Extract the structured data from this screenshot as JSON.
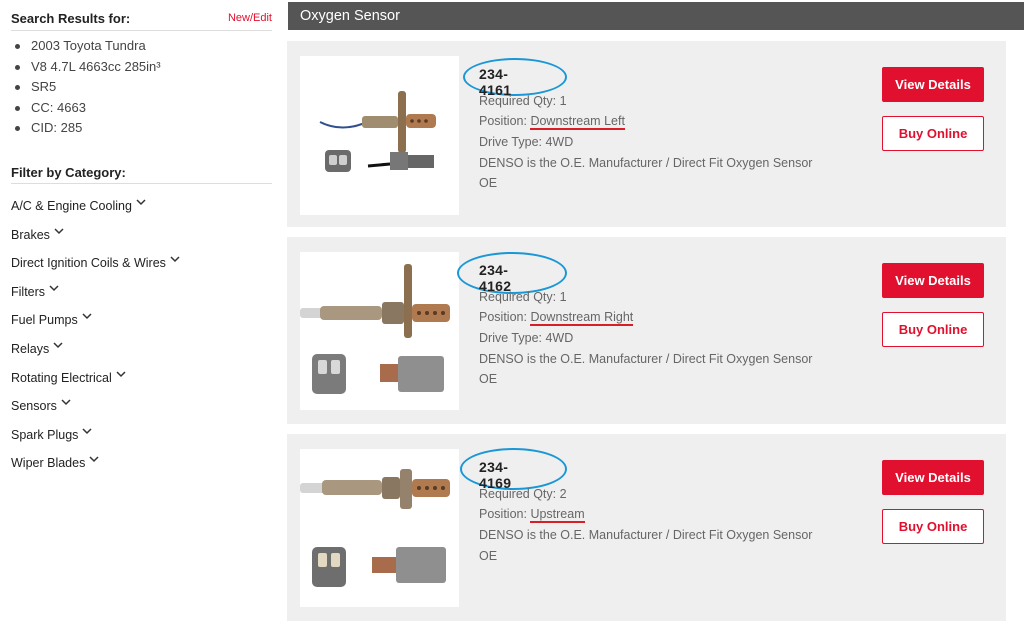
{
  "sidebar": {
    "search_title": "Search Results for:",
    "edit_link": "New/Edit",
    "vehicle": [
      "2003 Toyota Tundra",
      "V8 4.7L 4663cc 285in³",
      "SR5",
      "CC: 4663",
      "CID: 285"
    ],
    "filter_title": "Filter by Category:",
    "categories": [
      "A/C & Engine Cooling",
      "Brakes",
      "Direct Ignition Coils & Wires",
      "Filters",
      "Fuel Pumps",
      "Relays",
      "Rotating Electrical",
      "Sensors",
      "Spark Plugs",
      "Wiper Blades"
    ]
  },
  "main": {
    "section_title": "Oxygen Sensor",
    "products": [
      {
        "part_number": "234-4161",
        "qty_label": "Required Qty:",
        "qty": "1",
        "position_label": "Position:",
        "position": "Downstream Left",
        "drive_label": "Drive Type:",
        "drive": "4WD",
        "desc": "DENSO is the O.E. Manufacturer / Direct Fit Oxygen Sensor",
        "type": "OE",
        "view_label": "View Details",
        "buy_label": "Buy Online"
      },
      {
        "part_number": "234-4162",
        "qty_label": "Required Qty:",
        "qty": "1",
        "position_label": "Position:",
        "position": "Downstream Right",
        "drive_label": "Drive Type:",
        "drive": "4WD",
        "desc": "DENSO is the O.E. Manufacturer / Direct Fit Oxygen Sensor",
        "type": "OE",
        "view_label": "View Details",
        "buy_label": "Buy Online"
      },
      {
        "part_number": "234-4169",
        "qty_label": "Required Qty:",
        "qty": "2",
        "position_label": "Position:",
        "position": "Upstream",
        "desc": "DENSO is the O.E. Manufacturer / Direct Fit Oxygen Sensor",
        "type": "OE",
        "view_label": "View Details",
        "buy_label": "Buy Online"
      }
    ]
  },
  "colors": {
    "accent": "#e0102e",
    "header": "#555555",
    "card": "#efefef",
    "highlight_ring": "#1a97d6",
    "underline": "#d81f26"
  }
}
